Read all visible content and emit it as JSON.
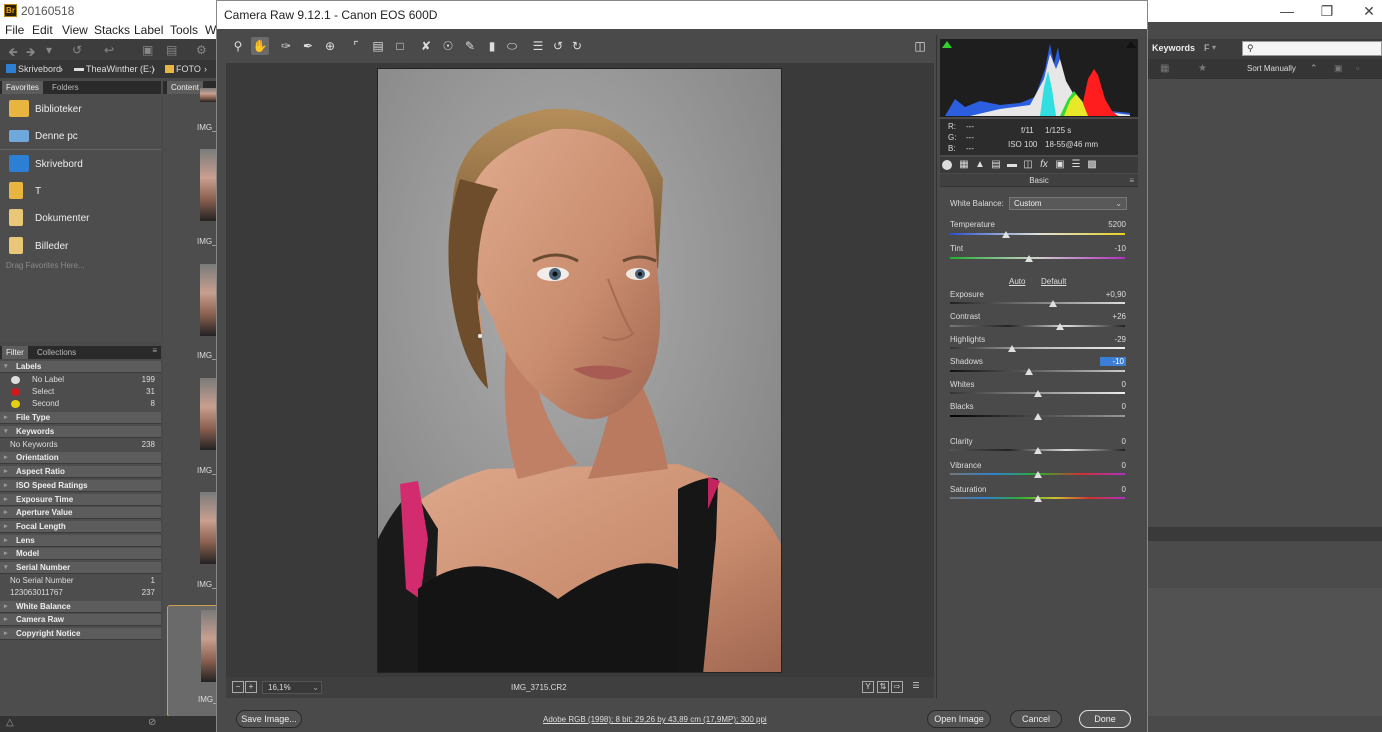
{
  "bridge": {
    "title": "20160518",
    "menu": [
      "File",
      "Edit",
      "View",
      "Stacks",
      "Label",
      "Tools",
      "W"
    ],
    "path": [
      "Skrivebord",
      "TheaWinther (E:)",
      "FOTO"
    ],
    "left_tabs": [
      "Favorites",
      "Folders"
    ],
    "content_tab": "Content",
    "favorites": [
      {
        "label": "Biblioteker"
      },
      {
        "label": "Denne pc"
      },
      {
        "label": "Skrivebord"
      },
      {
        "label": "T"
      },
      {
        "label": "Dokumenter"
      },
      {
        "label": "Billeder"
      }
    ],
    "favorites_hint": "Drag Favorites Here...",
    "filter_tabs": [
      "Filter",
      "Collections"
    ],
    "filter": {
      "labels_head": "Labels",
      "label_items": [
        {
          "name": "No Label",
          "count": "199",
          "color": "#dddddd"
        },
        {
          "name": "Select",
          "count": "31",
          "color": "#d11a1a"
        },
        {
          "name": "Second",
          "count": "8",
          "color": "#e5d00f"
        }
      ],
      "file_type": "File Type",
      "keywords_head": "Keywords",
      "keywords_item": {
        "name": "No Keywords",
        "count": "238"
      },
      "orientation": "Orientation",
      "aspect_ratio": "Aspect Ratio",
      "iso": "ISO Speed Ratings",
      "exposure_time": "Exposure Time",
      "aperture": "Aperture Value",
      "focal_length": "Focal Length",
      "lens": "Lens",
      "model": "Model",
      "serial_head": "Serial Number",
      "serial_items": [
        {
          "name": "No Serial Number",
          "count": "1"
        },
        {
          "name": "123063011767",
          "count": "237"
        }
      ],
      "white_balance": "White Balance",
      "camera_raw": "Camera Raw",
      "copyright": "Copyright Notice"
    },
    "thumb_labels": [
      "IMG_",
      "IMG_",
      "IMG_",
      "IMG_",
      "IMG_",
      "IMG_"
    ],
    "keywords_tab": "Keywords",
    "keywords_f": "F",
    "sort_label": "Sort Manually"
  },
  "camera_raw": {
    "title": "Camera Raw 9.12.1  -  Canon EOS 600D",
    "zoom": "16,1%",
    "filename": "IMG_3715.CR2",
    "readout": {
      "r_label": "R:",
      "g_label": "G:",
      "b_label": "B:",
      "r": "---",
      "g": "---",
      "b": "---",
      "aperture": "f/11",
      "shutter": "1/125 s",
      "iso": "ISO 100",
      "lens": "18-55@46 mm"
    },
    "panel_title": "Basic",
    "white_balance_label": "White Balance:",
    "white_balance_value": "Custom",
    "auto_label": "Auto",
    "default_label": "Default",
    "sliders": {
      "temperature": {
        "label": "Temperature",
        "value": "5200",
        "pos": 0.32
      },
      "tint": {
        "label": "Tint",
        "value": "-10",
        "pos": 0.45
      },
      "exposure": {
        "label": "Exposure",
        "value": "+0,90",
        "pos": 0.59
      },
      "contrast": {
        "label": "Contrast",
        "value": "+26",
        "pos": 0.63
      },
      "highlights": {
        "label": "Highlights",
        "value": "-29",
        "pos": 0.355
      },
      "shadows": {
        "label": "Shadows",
        "value": "-10",
        "pos": 0.45
      },
      "whites": {
        "label": "Whites",
        "value": "0",
        "pos": 0.5
      },
      "blacks": {
        "label": "Blacks",
        "value": "0",
        "pos": 0.5
      },
      "clarity": {
        "label": "Clarity",
        "value": "0",
        "pos": 0.5
      },
      "vibrance": {
        "label": "Vibrance",
        "value": "0",
        "pos": 0.5
      },
      "saturation": {
        "label": "Saturation",
        "value": "0",
        "pos": 0.5
      }
    },
    "footer": {
      "save": "Save Image...",
      "workflow": "Adobe RGB (1998); 8 bit; 29,26 by 43,89 cm (17,9MP); 300 ppi",
      "open": "Open Image",
      "cancel": "Cancel",
      "done": "Done"
    }
  }
}
